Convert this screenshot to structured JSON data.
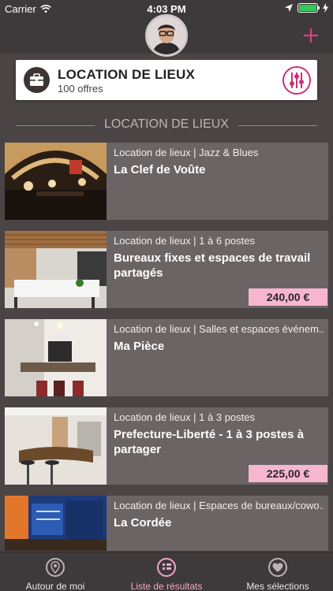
{
  "status": {
    "carrier": "Carrier",
    "time": "4:03 PM"
  },
  "category": {
    "title": "LOCATION DE LIEUX",
    "count": "100 offres"
  },
  "section_title": "LOCATION DE LIEUX",
  "listings": [
    {
      "meta": "Location de lieux | Jazz & Blues",
      "name": "La Clef de Voûte",
      "price": ""
    },
    {
      "meta": "Location de lieux | 1 à 6 postes",
      "name": "Bureaux fixes et espaces de travail partagés",
      "price": "240,00 €"
    },
    {
      "meta": "Location de lieux | Salles et espaces événem...",
      "name": "Ma Pièce",
      "price": ""
    },
    {
      "meta": "Location de lieux | 1 à 3 postes",
      "name": "Prefecture-Liberté - 1 à 3 postes à partager",
      "price": "225,00 €"
    },
    {
      "meta": "Location de lieux | Espaces de bureaux/cowo...",
      "name": "La Cordée",
      "price": ""
    }
  ],
  "tabs": [
    {
      "label": "Autour de moi",
      "icon": "location-pin-icon",
      "active": false
    },
    {
      "label": "Liste de résultats",
      "icon": "list-icon",
      "active": true
    },
    {
      "label": "Mes sélections",
      "icon": "heart-icon",
      "active": false
    }
  ],
  "colors": {
    "accent": "#e23c89",
    "price_bg": "#f6b6cf",
    "active_tab": "#f0a8c6"
  }
}
